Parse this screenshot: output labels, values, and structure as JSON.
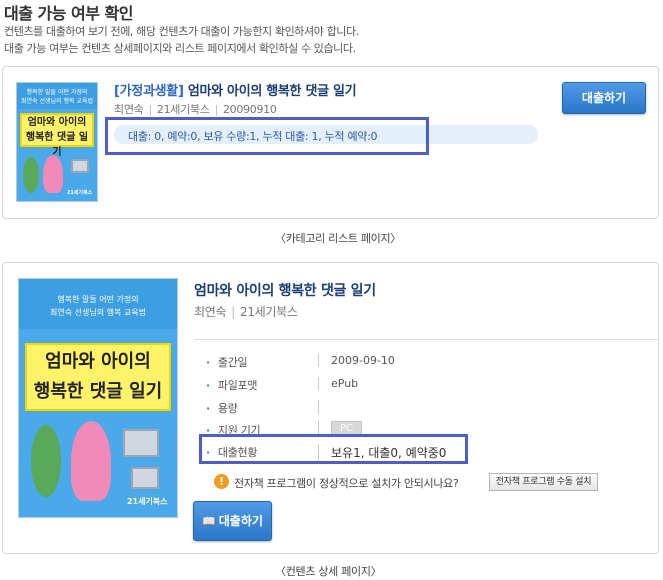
{
  "header": {
    "title": "대출 가능 여부 확인",
    "desc1": "컨텐츠를 대출하여 보기 전에, 해당 컨텐츠가 대출이 가능한지 확인하셔야 합니다.",
    "desc2": "대출 가능 여부는 컨텐츠 상세페이지와 리스트 페이지에서 확인하실 수 있습니다."
  },
  "cover": {
    "top_text_small": "행복한 말들 어떤 가정의",
    "top_text_line2": "최연숙 선생님의 행복 교육법",
    "title_line1": "엄마와 아이의",
    "title_line2": "행복한 댓글 일기",
    "publisher": "21세기북스"
  },
  "list_section": {
    "category": "[가정과생활]",
    "book_title": "엄마와 아이의 행복한 댓글 일기",
    "author": "최연숙",
    "publisher": "21세기북스",
    "date": "20090910",
    "status_text": "대출: 0, 예약:0, 보유 수량:1, 누적 대출: 1, 누적 예약:0",
    "borrow_button": "대출하기",
    "caption": "〈카테고리 리스트 페이지〉"
  },
  "detail_section": {
    "book_title": "엄마와 아이의 행복한 댓글 일기",
    "author": "최연숙",
    "publisher": "21세기북스",
    "fields": [
      {
        "label": "출간일",
        "value": "2009-09-10"
      },
      {
        "label": "파일포맷",
        "value": "ePub"
      },
      {
        "label": "용량",
        "value": ""
      },
      {
        "label": "지원 기기",
        "value": "PC"
      },
      {
        "label": "대출현황",
        "value": "보유1, 대출0, 예약중0"
      }
    ],
    "notice_text": "전자책 프로그램이 정상적으로 설치가 안되시나요?",
    "manual_install_button": "전자책 프로그램 수동 설치",
    "borrow_button": "대출하기",
    "caption": "〈컨텐츠 상세 페이지〉"
  },
  "colors": {
    "accent_blue": "#2b77c8",
    "highlight_border": "#4d5ec7",
    "status_bg": "#e3f0fb",
    "warn_orange": "#f39a1c"
  },
  "icons": {
    "warning": "warning-icon",
    "book": "book-icon"
  }
}
